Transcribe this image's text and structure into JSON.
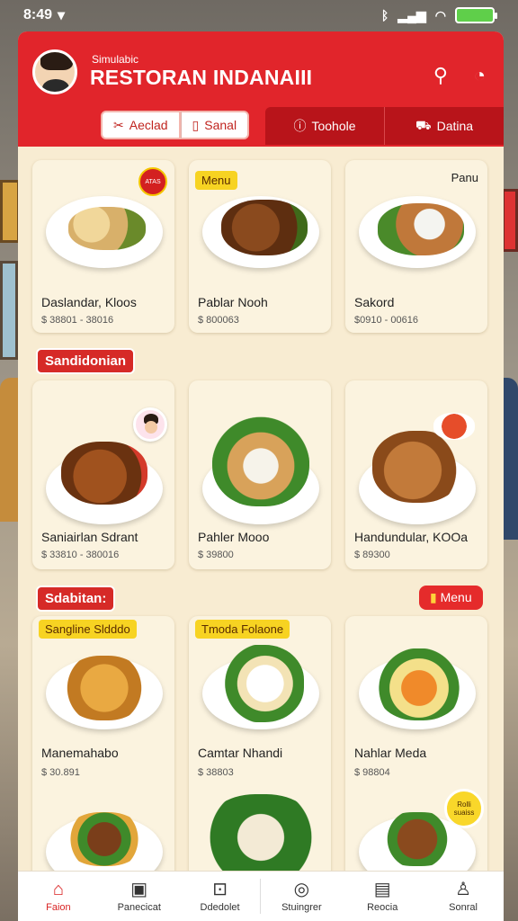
{
  "status_bar": {
    "time": "8:49",
    "battery": ""
  },
  "header": {
    "subtitle": "Simulabic",
    "title": "RESTORAN INDANAIII",
    "tabs_light": [
      {
        "label": "Aeclad",
        "icon": "fork-icon"
      },
      {
        "label": "Sanal",
        "icon": "bookmark-icon"
      }
    ],
    "tabs_dark": [
      {
        "label": "Toohole",
        "icon": "info-icon"
      },
      {
        "label": "Datina",
        "icon": "car-icon"
      }
    ]
  },
  "cards": [
    {
      "name": "Daslandar, Kloos",
      "price": "$ 38801 - 38016",
      "badge": "",
      "round_badge": "ATAS"
    },
    {
      "name": "Pablar Nooh",
      "price": "$ 800063",
      "badge": "Menu"
    },
    {
      "name": "Sakord",
      "price": "$0910 - 00616",
      "corner": "Panu"
    },
    {
      "name": "Saniairlan Sdrant",
      "price": "$ 33810 - 380016"
    },
    {
      "name": "Pahler Mooo",
      "price": "$ 39800"
    },
    {
      "name": "Handundular, KOOa",
      "price": "$ 89300"
    },
    {
      "name": "Manemahabo",
      "price": "$ 30.891",
      "badge": "Sangline Sldddo"
    },
    {
      "name": "Camtar Nhandi",
      "price": "$ 38803",
      "badge": "Tmoda Folaone"
    },
    {
      "name": "Nahlar Meda",
      "price": "$ 98804",
      "seal": "Rolli\nsuaiss"
    }
  ],
  "sections": {
    "second": "Sandidonian",
    "third": "Sdabitan:",
    "menu_button": "Menu"
  },
  "bottom_nav": [
    {
      "label": "Faion",
      "icon": "home-icon",
      "active": true
    },
    {
      "label": "Panecicat",
      "icon": "phone-icon"
    },
    {
      "label": "Ddedolet",
      "icon": "gamepad-icon"
    },
    {
      "label": "Stuingrer",
      "icon": "chat-icon"
    },
    {
      "label": "Reocia",
      "icon": "bag-icon"
    },
    {
      "label": "Sonral",
      "icon": "profile-icon"
    }
  ],
  "colors": {
    "brand_red": "#e1252b",
    "dark_red": "#b8141a",
    "cream": "#f8ecd2",
    "yellow": "#f7d322"
  }
}
